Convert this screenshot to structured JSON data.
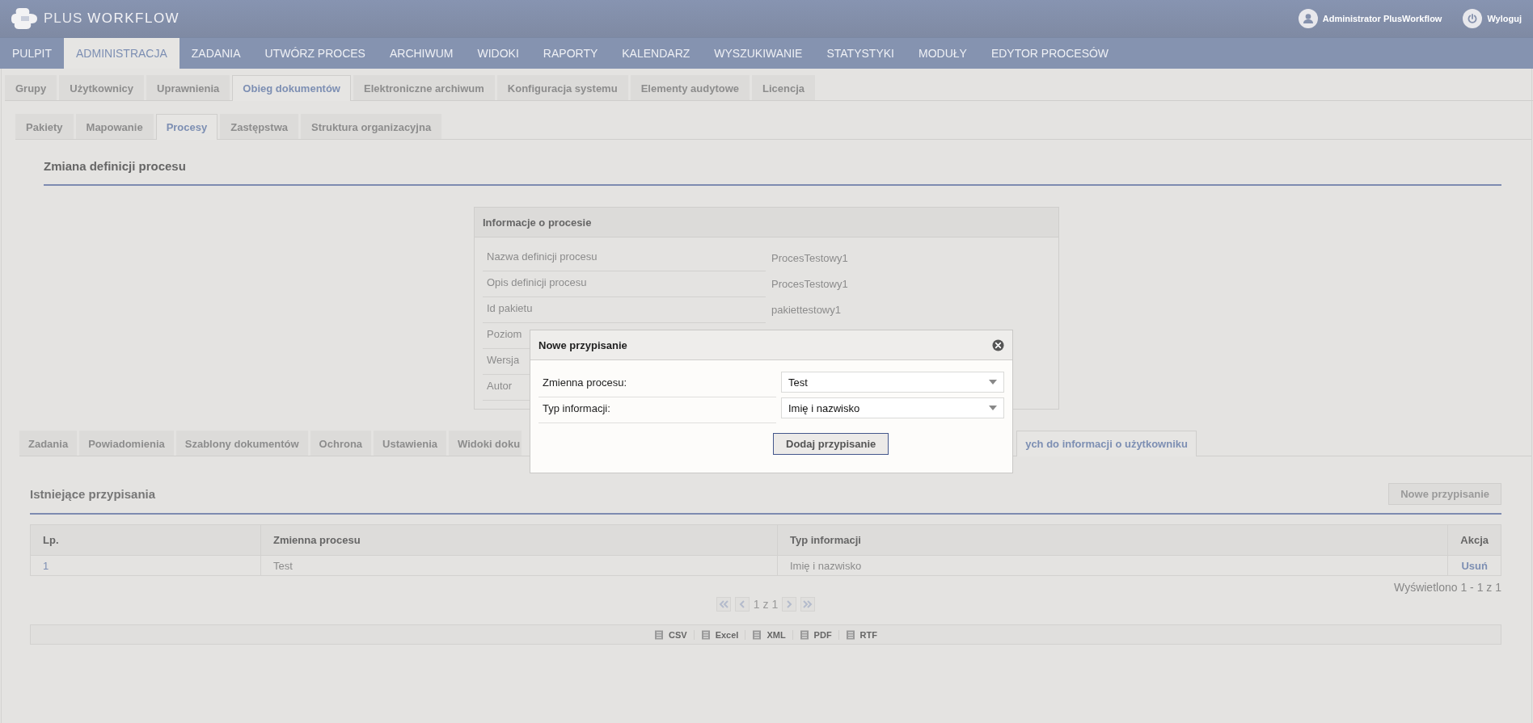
{
  "header": {
    "logo": {
      "light": "PLUS",
      "bold": "WORKFLOW"
    },
    "user": "Administrator PlusWorkflow",
    "logout": "Wyloguj"
  },
  "nav": [
    {
      "label": "PULPIT",
      "selected": false
    },
    {
      "label": "ADMINISTRACJA",
      "selected": true
    },
    {
      "label": "ZADANIA",
      "selected": false
    },
    {
      "label": "UTWÓRZ PROCES",
      "selected": false
    },
    {
      "label": "ARCHIWUM",
      "selected": false
    },
    {
      "label": "WIDOKI",
      "selected": false
    },
    {
      "label": "RAPORTY",
      "selected": false
    },
    {
      "label": "KALENDARZ",
      "selected": false
    },
    {
      "label": "WYSZUKIWANIE",
      "selected": false
    },
    {
      "label": "STATYSTYKI",
      "selected": false
    },
    {
      "label": "MODUŁY",
      "selected": false
    },
    {
      "label": "EDYTOR PROCESÓW",
      "selected": false
    }
  ],
  "admin_tabs": [
    {
      "label": "Grupy",
      "selected": false
    },
    {
      "label": "Użytkownicy",
      "selected": false
    },
    {
      "label": "Uprawnienia",
      "selected": false
    },
    {
      "label": "Obieg dokumentów",
      "selected": true
    },
    {
      "label": "Elektroniczne archiwum",
      "selected": false
    },
    {
      "label": "Konfiguracja systemu",
      "selected": false
    },
    {
      "label": "Elementy audytowe",
      "selected": false
    },
    {
      "label": "Licencja",
      "selected": false
    }
  ],
  "sub_tabs": [
    {
      "label": "Pakiety",
      "selected": false
    },
    {
      "label": "Mapowanie",
      "selected": false
    },
    {
      "label": "Procesy",
      "selected": true
    },
    {
      "label": "Zastępstwa",
      "selected": false
    },
    {
      "label": "Struktura organizacyjna",
      "selected": false
    }
  ],
  "section_title": "Zmiana definicji procesu",
  "info_panel": {
    "title": "Informacje o procesie",
    "rows": [
      {
        "label": "Nazwa definicji procesu",
        "value": "ProcesTestowy1"
      },
      {
        "label": "Opis definicji procesu",
        "value": "ProcesTestowy1"
      },
      {
        "label": "Id pakietu",
        "value": "pakiettestowy1"
      },
      {
        "label": "Poziom"
      },
      {
        "label": "Wersja"
      },
      {
        "label": "Autor"
      }
    ]
  },
  "process_tabs": [
    {
      "label": "Zadania",
      "selected": false
    },
    {
      "label": "Powiadomienia",
      "selected": false
    },
    {
      "label": "Szablony dokumentów",
      "selected": false
    },
    {
      "label": "Ochrona",
      "selected": false
    },
    {
      "label": "Ustawienia",
      "selected": false
    },
    {
      "label": "Widoki doku",
      "selected": false
    },
    {
      "label": "ych do informacji o użytkowniku",
      "selected": true
    }
  ],
  "assignments": {
    "title": "Istniejące przypisania",
    "new_button": "Nowe przypisanie",
    "table": {
      "columns": [
        "Lp.",
        "Zmienna procesu",
        "Typ informacji",
        "Akcja"
      ],
      "rows": [
        {
          "lp": "1",
          "variable": "Test",
          "type": "Imię i nazwisko",
          "action": "Usuń"
        }
      ]
    },
    "summary": "Wyświetlono 1 - 1 z 1",
    "page": "1 z 1",
    "exports": [
      "CSV",
      "Excel",
      "XML",
      "PDF",
      "RTF"
    ]
  },
  "modal": {
    "title": "Nowe przypisanie",
    "fields": [
      {
        "label": "Zmienna procesu:",
        "value": "Test"
      },
      {
        "label": "Typ informacji:",
        "value": "Imię i nazwisko"
      }
    ],
    "button": "Dodaj przypisanie"
  }
}
